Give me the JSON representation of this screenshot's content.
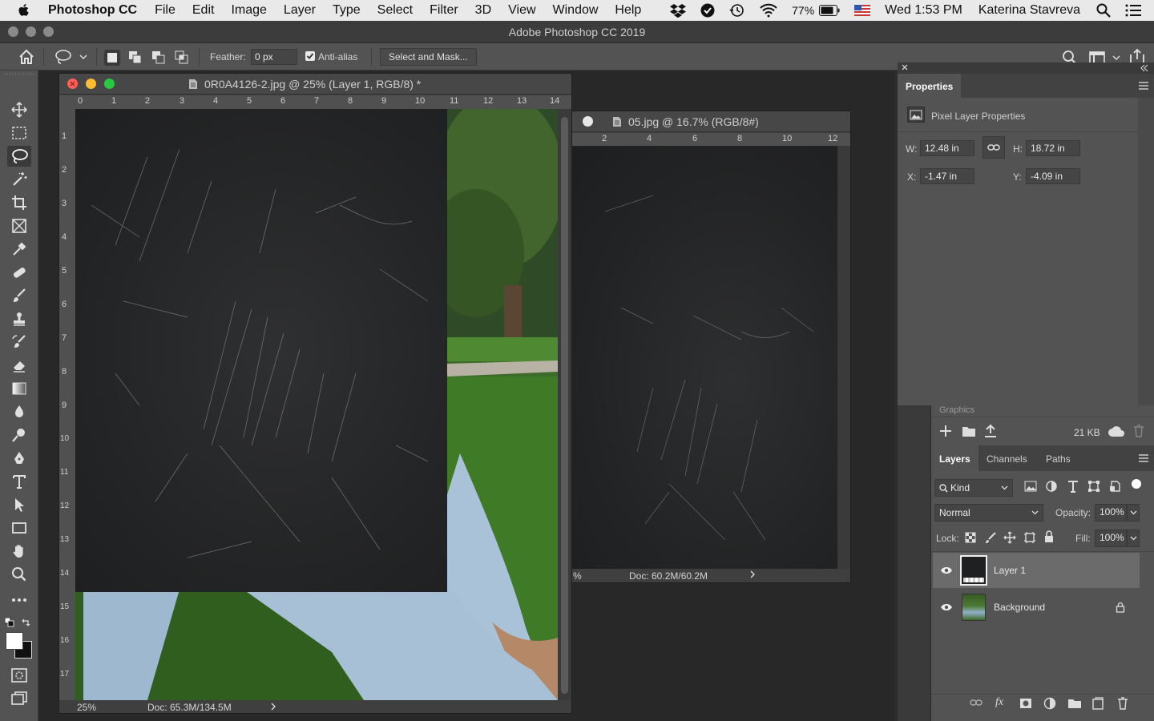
{
  "menubar": {
    "app_name": "Photoshop CC",
    "items": [
      "File",
      "Edit",
      "Image",
      "Layer",
      "Type",
      "Select",
      "Filter",
      "3D",
      "View",
      "Window",
      "Help"
    ],
    "battery": "77%",
    "clock": "Wed 1:53 PM",
    "user": "Katerina Stavreva"
  },
  "window": {
    "title": "Adobe Photoshop CC 2019"
  },
  "options": {
    "feather_label": "Feather:",
    "feather_value": "0 px",
    "antialias_label": "Anti-alias",
    "select_mask_label": "Select and Mask..."
  },
  "doc1": {
    "title": "0R0A4126-2.jpg @ 25% (Layer 1, RGB/8) *",
    "zoom": "25%",
    "doc_size": "Doc: 65.3M/134.5M",
    "ruler_h": [
      "0",
      "1",
      "2",
      "3",
      "4",
      "5",
      "6",
      "7",
      "8",
      "9",
      "10",
      "11",
      "12",
      "13",
      "14"
    ],
    "ruler_v": [
      "1",
      "2",
      "3",
      "4",
      "5",
      "6",
      "7",
      "8",
      "9",
      "10",
      "11",
      "12",
      "13",
      "14",
      "15",
      "16",
      "17"
    ]
  },
  "doc2": {
    "title": "05.jpg @ 16.7% (RGB/8#)",
    "zoom": "%",
    "doc_size": "Doc: 60.2M/60.2M",
    "ruler_h": [
      "2",
      "4",
      "6",
      "8",
      "10",
      "12"
    ]
  },
  "properties": {
    "tab": "Properties",
    "heading": "Pixel Layer Properties",
    "w_label": "W:",
    "w_value": "12.48 in",
    "h_label": "H:",
    "h_value": "18.72 in",
    "x_label": "X:",
    "x_value": "-1.47 in",
    "y_label": "Y:",
    "y_value": "-4.09 in"
  },
  "libraries": {
    "section": "Graphics",
    "size": "21 KB"
  },
  "layers": {
    "tabs": [
      "Layers",
      "Channels",
      "Paths"
    ],
    "filter": "Kind",
    "blend_mode": "Normal",
    "opacity_label": "Opacity:",
    "opacity_value": "100%",
    "lock_label": "Lock:",
    "fill_label": "Fill:",
    "fill_value": "100%",
    "items": [
      {
        "name": "Layer 1"
      },
      {
        "name": "Background"
      }
    ]
  }
}
